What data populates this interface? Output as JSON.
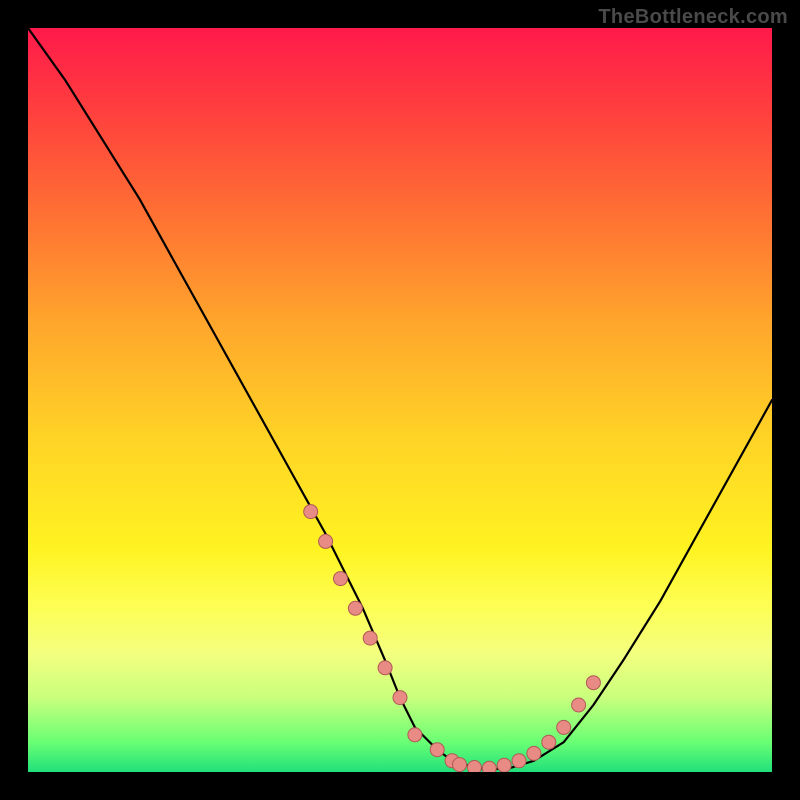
{
  "watermark": "TheBottleneck.com",
  "colors": {
    "background": "#000000",
    "gradient_top": "#ff1a4b",
    "gradient_bottom": "#21e07a",
    "curve": "#000000",
    "dot_fill": "#e88b85",
    "dot_stroke": "#b05a55"
  },
  "chart_data": {
    "type": "line",
    "title": "",
    "xlabel": "",
    "ylabel": "",
    "xlim": [
      0,
      100
    ],
    "ylim": [
      0,
      100
    ],
    "grid": false,
    "legend": false,
    "series": [
      {
        "name": "bottleneck-curve",
        "x": [
          0,
          5,
          10,
          15,
          20,
          25,
          30,
          35,
          40,
          45,
          48,
          50,
          52,
          55,
          57,
          60,
          62,
          65,
          68,
          72,
          76,
          80,
          85,
          90,
          95,
          100
        ],
        "values": [
          100,
          93,
          85,
          77,
          68,
          59,
          50,
          41,
          32,
          22,
          15,
          10,
          6,
          3,
          1.5,
          0.6,
          0.3,
          0.6,
          1.5,
          4,
          9,
          15,
          23,
          32,
          41,
          50
        ]
      }
    ],
    "markers": {
      "name": "highlighted-points",
      "x": [
        38,
        40,
        42,
        44,
        46,
        48,
        50,
        52,
        55,
        57,
        58,
        60,
        62,
        64,
        66,
        68,
        70,
        72,
        74,
        76
      ],
      "values": [
        35,
        31,
        26,
        22,
        18,
        14,
        10,
        5,
        3,
        1.5,
        1,
        0.6,
        0.5,
        0.9,
        1.5,
        2.5,
        4,
        6,
        9,
        12
      ]
    }
  }
}
